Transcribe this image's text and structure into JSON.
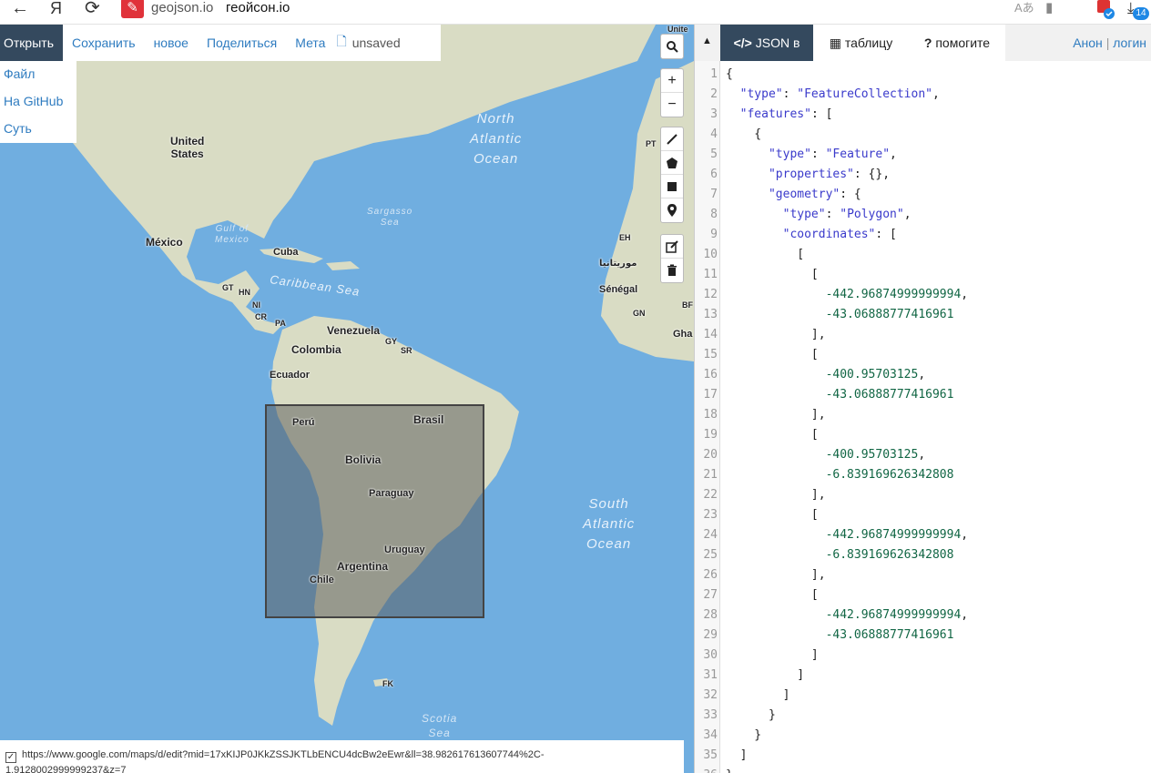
{
  "browser": {
    "back_icon": "←",
    "yandex_icon": "Я",
    "reload_icon": "⟳",
    "domain": "geojson.io",
    "page_title": "геойсон.io",
    "download_count": "14"
  },
  "menu": {
    "items": [
      "Открыть",
      "Сохранить",
      "новое",
      "Поделиться",
      "Мета"
    ],
    "unsaved": "unsaved"
  },
  "dropdown": [
    "Файл",
    "На GitHub",
    "Суть"
  ],
  "map": {
    "country_labels": [
      {
        "text": "United\nStates"
      },
      {
        "text": "México"
      },
      {
        "text": "Cuba"
      },
      {
        "text": "Venezuela"
      },
      {
        "text": "Colombia"
      },
      {
        "text": "Ecuador"
      },
      {
        "text": "Perú"
      },
      {
        "text": "Brasil"
      },
      {
        "text": "Bolivia"
      },
      {
        "text": "Paraguay"
      },
      {
        "text": "Uruguay"
      },
      {
        "text": "Argentina"
      },
      {
        "text": "Chile"
      },
      {
        "text": "Sénégal"
      },
      {
        "text": "موريتانيا"
      }
    ],
    "small_labels": [
      "GT",
      "HN",
      "NI",
      "CR",
      "PA",
      "GY",
      "SR",
      "FK",
      "EH",
      "GN",
      "BF",
      "PT",
      "Gha",
      "Unite"
    ],
    "ocean_labels": [
      "North\nAtlantic\nOcean",
      "South\nAtlantic\nOcean",
      "Caribbean Sea",
      "Sargasso\nSea",
      "Gulf of\nMexico",
      "Scotia\nSea"
    ],
    "colors": {
      "water": "#70aee0",
      "land": "#d9dcc4",
      "selection": "#555555"
    }
  },
  "toolbar": {
    "search_icon": "search-icon",
    "zoom_in": "+",
    "zoom_out": "−"
  },
  "footer": {
    "checked": "✓",
    "url_line1": "https://www.google.com/maps/d/edit?mid=17xKIJP0JKkZSSJKTLbENCU4dcBw2eEwr&ll=38.982617613607744%2C-",
    "url_line2": "1.9128002999999237&z=7"
  },
  "panel": {
    "tabs": [
      "JSON в",
      "таблицу",
      "помогите"
    ],
    "tab_icons": [
      "</>",
      "▦",
      "?"
    ],
    "auth_anon": "Анон",
    "auth_sep": "|",
    "auth_login": "логин"
  },
  "editor": {
    "lines": [
      "{",
      "  \"type\": \"FeatureCollection\",",
      "  \"features\": [",
      "    {",
      "      \"type\": \"Feature\",",
      "      \"properties\": {},",
      "      \"geometry\": {",
      "        \"type\": \"Polygon\",",
      "        \"coordinates\": [",
      "          [",
      "            [",
      "              -442.96874999999994,",
      "              -43.06888777416961",
      "            ],",
      "            [",
      "              -400.95703125,",
      "              -43.06888777416961",
      "            ],",
      "            [",
      "              -400.95703125,",
      "              -6.839169626342808",
      "            ],",
      "            [",
      "              -442.96874999999994,",
      "              -6.839169626342808",
      "            ],",
      "            [",
      "              -442.96874999999994,",
      "              -43.06888777416961",
      "            ]",
      "          ]",
      "        ]",
      "      }",
      "    }",
      "  ]",
      "}"
    ]
  }
}
